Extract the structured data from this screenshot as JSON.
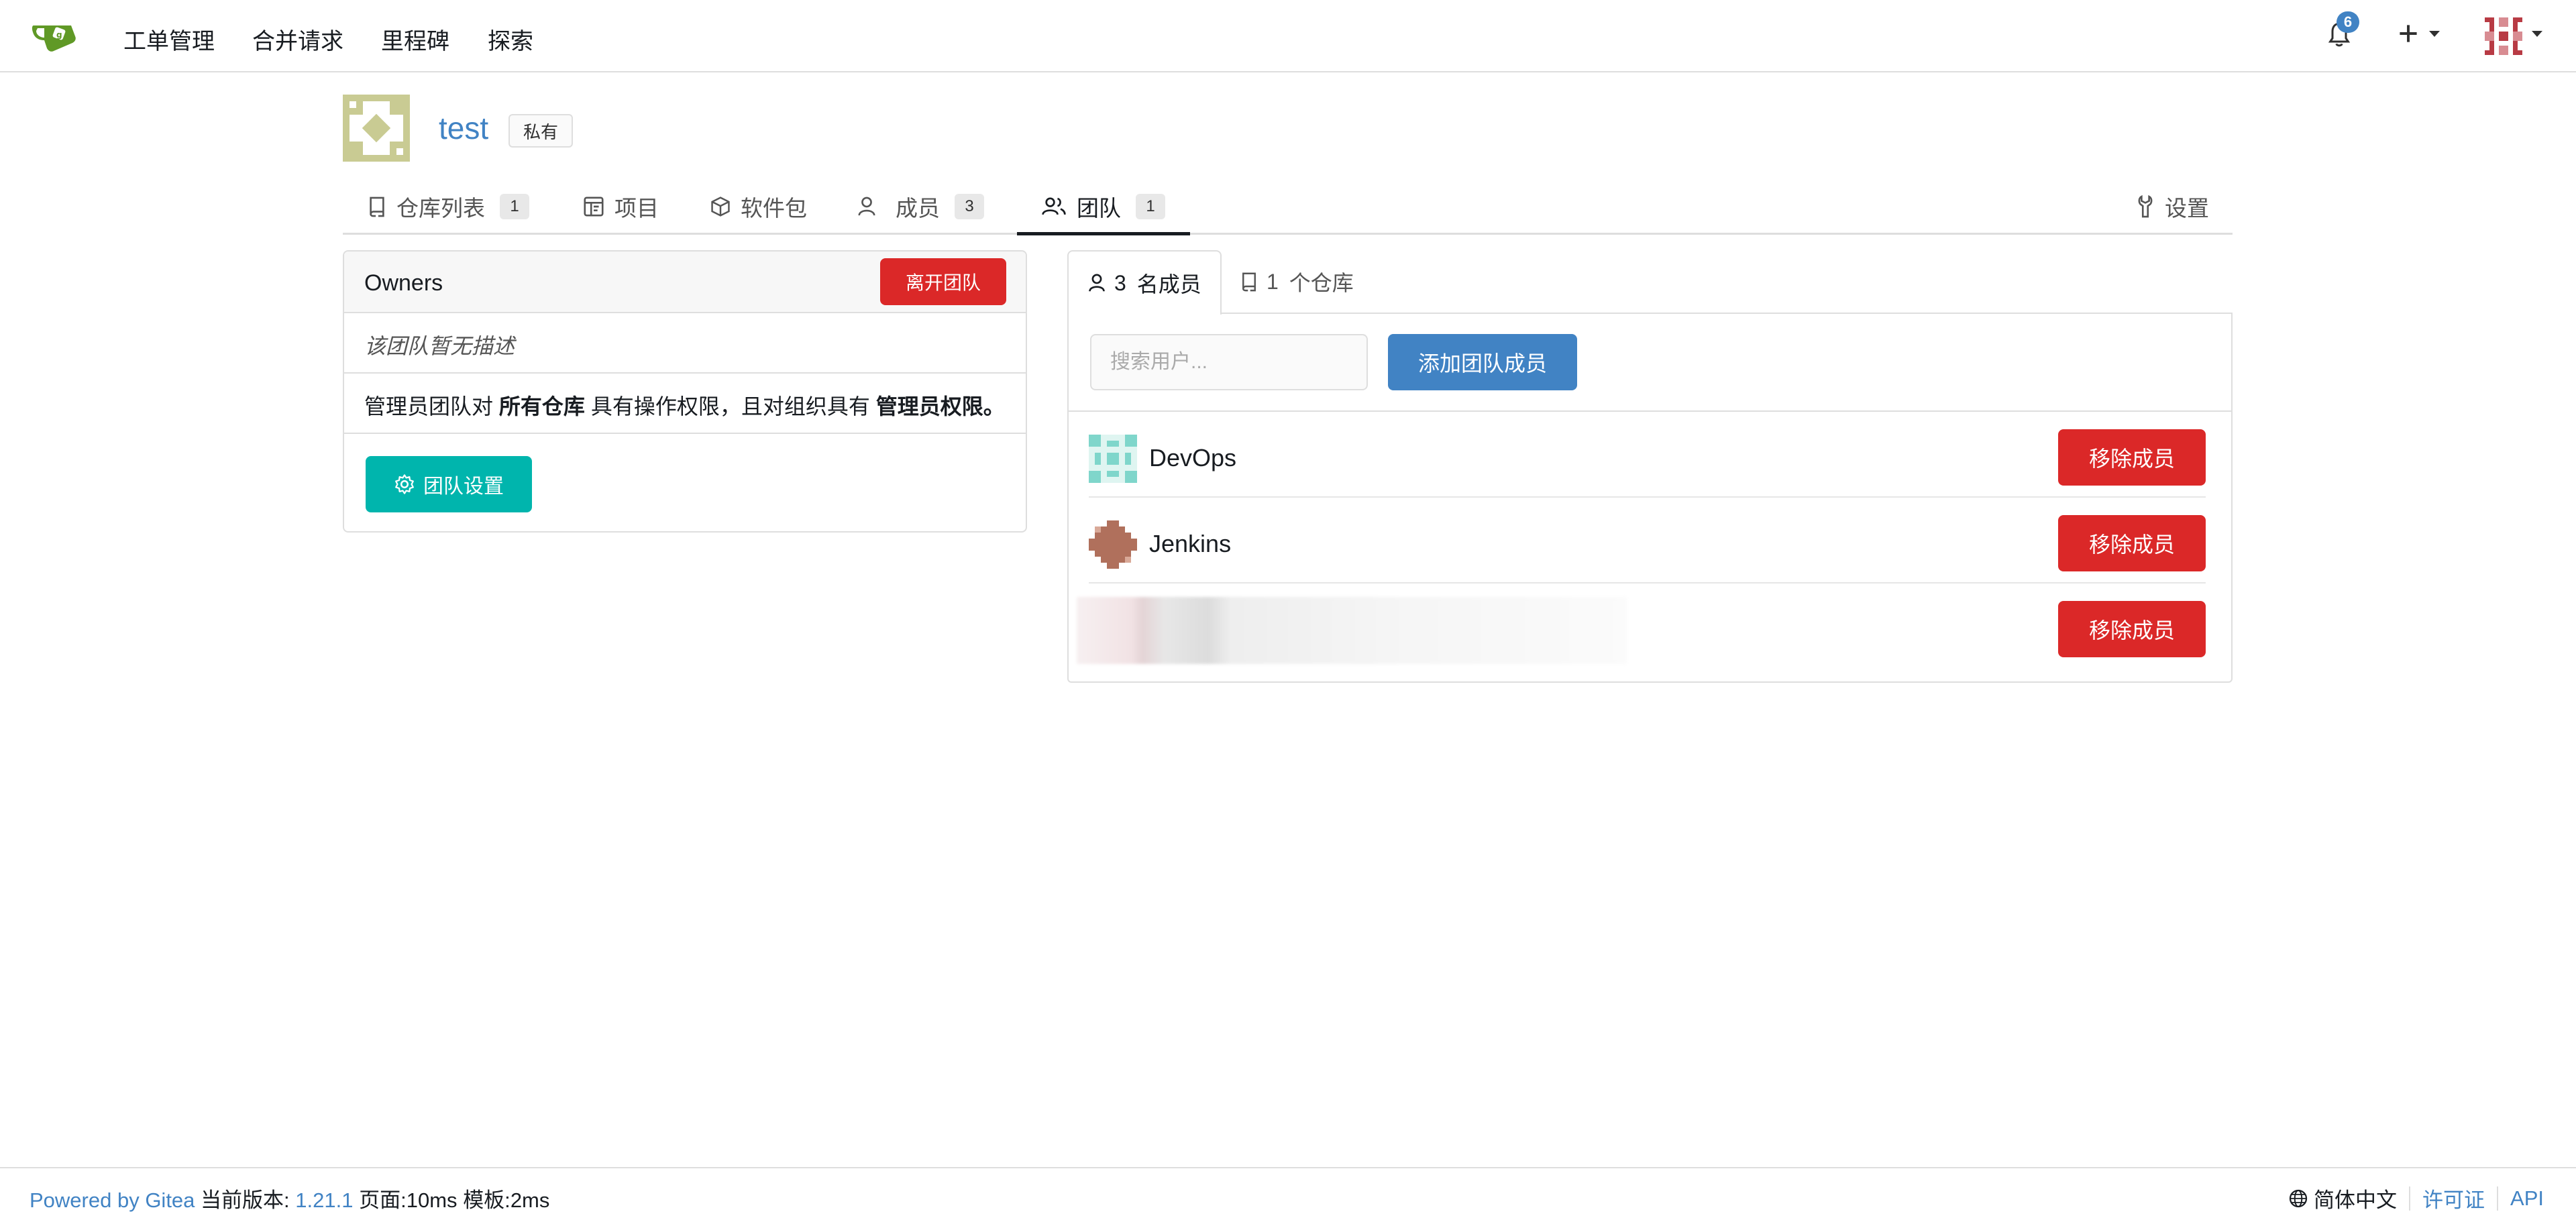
{
  "navbar": {
    "items": [
      "工单管理",
      "合并请求",
      "里程碑",
      "探索"
    ],
    "notification_count": "6"
  },
  "org": {
    "name": "test",
    "visibility": "私有"
  },
  "tabs": [
    {
      "label": "仓库列表",
      "count": "1"
    },
    {
      "label": "项目"
    },
    {
      "label": "软件包"
    },
    {
      "label": "成员",
      "count": "3"
    },
    {
      "label": "团队",
      "count": "1"
    },
    {
      "label": "设置"
    }
  ],
  "team": {
    "name": "Owners",
    "leave_button": "离开团队",
    "description": "该团队暂无描述",
    "perm_prefix": "管理员团队对",
    "perm_bold1": "所有仓库",
    "perm_mid": "具有操作权限，且对组织具有",
    "perm_bold2": "管理员权限。",
    "settings_button": "团队设置"
  },
  "members_tabs": {
    "members_count": "3",
    "members_label": "名成员",
    "repos_count": "1",
    "repos_label": "个仓库"
  },
  "members": {
    "search_placeholder": "搜索用户...",
    "add_button": "添加团队成员",
    "list": [
      {
        "name": "DevOps",
        "remove": "移除成员"
      },
      {
        "name": "Jenkins",
        "remove": "移除成员"
      },
      {
        "name": "",
        "remove": "移除成员"
      }
    ]
  },
  "footer": {
    "powered": "Powered by Gitea",
    "version_label": "当前版本:",
    "version": "1.21.1",
    "page_label": "页面:",
    "page_time": "10ms",
    "template_label": "模板:",
    "template_time": "2ms",
    "language": "简体中文",
    "license": "许可证",
    "api": "API"
  },
  "colors": {
    "accent_blue": "#4183c4",
    "danger_red": "#db2828",
    "teal": "#00b5ad"
  }
}
